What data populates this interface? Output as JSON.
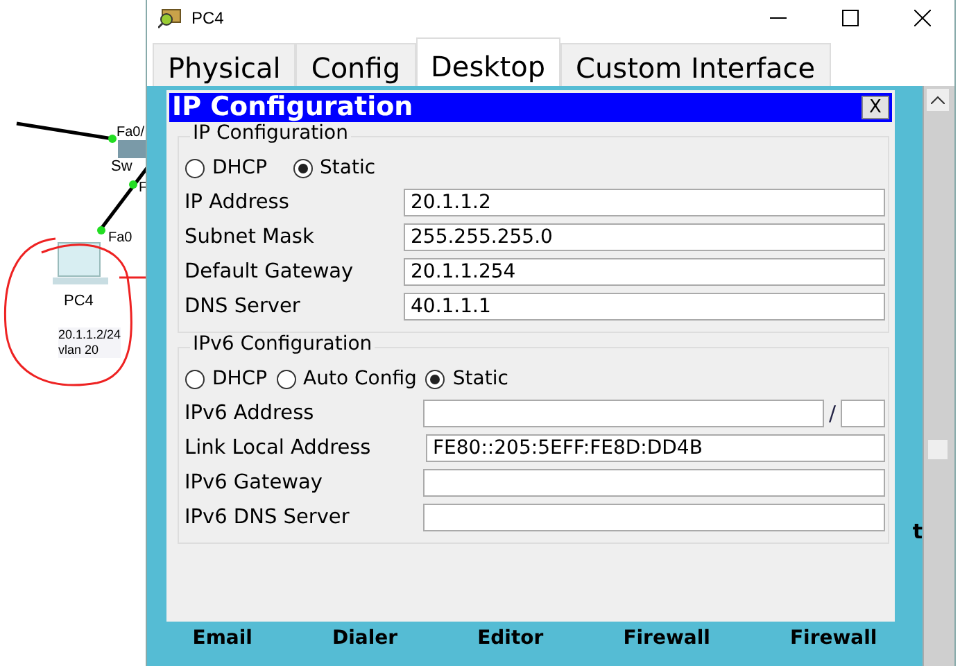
{
  "topology": {
    "port_labels": [
      "Fa0/",
      "F",
      "Fa0"
    ],
    "switch_label": "Sw",
    "pc": {
      "name": "PC4",
      "address": "20.1.1.2/24",
      "vlan": "vlan 20"
    }
  },
  "window": {
    "title": "PC4"
  },
  "tabs": [
    {
      "label": "Physical",
      "selected": false
    },
    {
      "label": "Config",
      "selected": false
    },
    {
      "label": "Desktop",
      "selected": true
    },
    {
      "label": "Custom Interface",
      "selected": false
    }
  ],
  "dialog": {
    "title": "IP Configuration",
    "close": "X",
    "ipv4": {
      "title": "IP Configuration",
      "modes": [
        {
          "label": "DHCP",
          "selected": false
        },
        {
          "label": "Static",
          "selected": true
        }
      ],
      "fields": [
        {
          "label": "IP Address",
          "value": "20.1.1.2"
        },
        {
          "label": "Subnet Mask",
          "value": "255.255.255.0"
        },
        {
          "label": "Default Gateway",
          "value": "20.1.1.254"
        },
        {
          "label": "DNS Server",
          "value": "40.1.1.1"
        }
      ]
    },
    "ipv6": {
      "title": "IPv6 Configuration",
      "modes": [
        {
          "label": "DHCP",
          "selected": false
        },
        {
          "label": "Auto Config",
          "selected": false
        },
        {
          "label": "Static",
          "selected": true
        }
      ],
      "fields": [
        {
          "label": "IPv6 Address",
          "kind": "prefix",
          "separator": "/"
        },
        {
          "label": "Link Local Address",
          "value": "FE80::205:5EFF:FE8D:DD4B"
        },
        {
          "label": "IPv6 Gateway"
        },
        {
          "label": "IPv6 DNS Server"
        }
      ]
    }
  },
  "desktop_apps": [
    "Email",
    "Dialer",
    "Editor",
    "Firewall",
    "Firewall"
  ],
  "side_label": "t"
}
